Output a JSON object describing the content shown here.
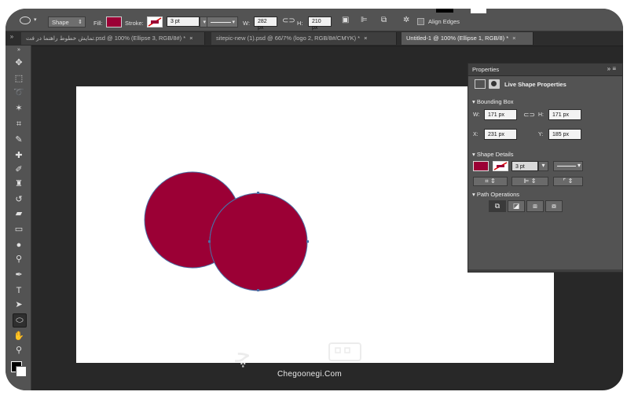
{
  "options_bar": {
    "mode": "Shape",
    "fill_label": "Fill:",
    "stroke_label": "Stroke:",
    "stroke_width": "3 pt",
    "w_label": "W:",
    "w_value": "282 px",
    "h_label": "H:",
    "h_value": "210 px",
    "align_edges_label": "Align Edges",
    "fill_color": "#9b0035"
  },
  "tabs": [
    {
      "label": "تمایش خطوط راهنما در فت.psd @ 100% (Ellipse 3, RGB/8#) *",
      "active": false
    },
    {
      "label": "sitepic-new (1).psd @ 66/7% (logo 2, RGB/8#/CMYK) *",
      "active": false
    },
    {
      "label": "Untitled-1 @ 100% (Ellipse 1, RGB/8) *",
      "active": true
    }
  ],
  "properties": {
    "title": "Properties",
    "subtitle": "Live Shape Properties",
    "bounding_box": "Bounding Box",
    "w_label": "W:",
    "w_value": "171 px",
    "h_label": "H:",
    "h_value": "171 px",
    "x_label": "X:",
    "x_value": "231 px",
    "y_label": "Y:",
    "y_value": "185 px",
    "shape_details": "Shape Details",
    "stroke_width": "3 pt",
    "path_operations": "Path Operations"
  },
  "shapes": {
    "fill": "#9b0035",
    "stroke": "#4a6fa5"
  },
  "watermark": {
    "brand": "Chegoonegi.Com"
  }
}
